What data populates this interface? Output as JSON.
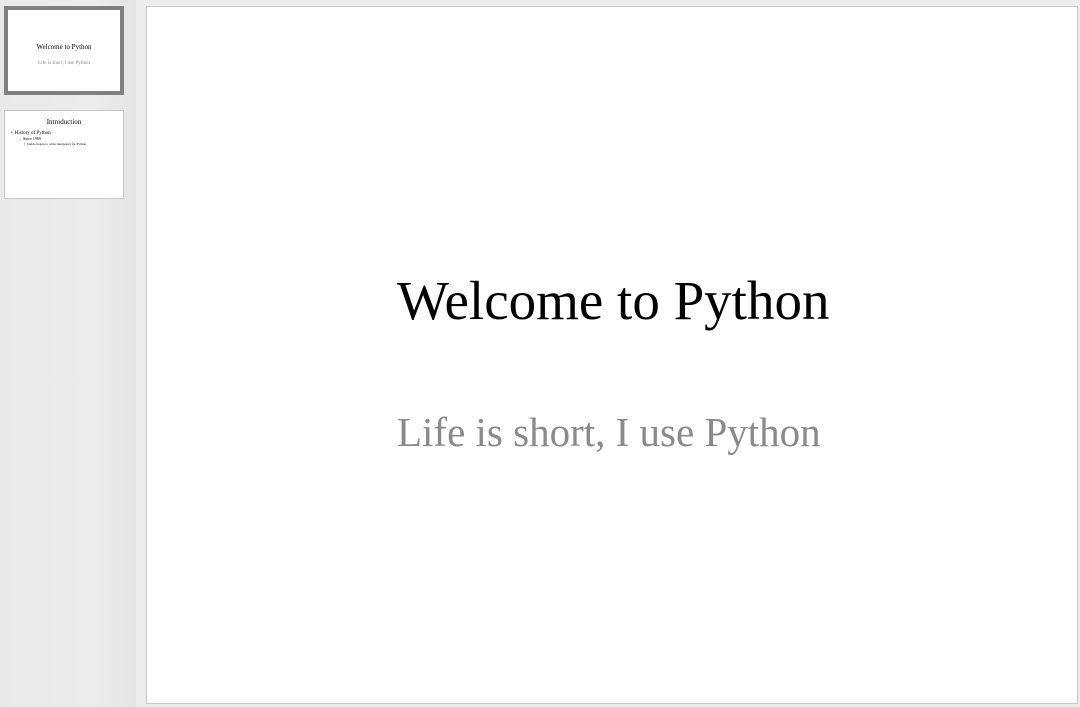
{
  "slides": [
    {
      "title": "Welcome to Python",
      "subtitle": "Life is short, I use Python"
    },
    {
      "title": "Introduction",
      "bullets": [
        {
          "bullet": "•",
          "text": "History of Python"
        },
        {
          "bullet": "–",
          "text": "Since 1989"
        },
        {
          "bullet": "•",
          "text": "Guido began to write interpreter for Python."
        }
      ]
    }
  ],
  "current_slide": {
    "title": "Welcome to Python",
    "subtitle": "Life is short, I use Python"
  },
  "colors": {
    "selected_border": "#808080",
    "subtitle_text": "#8a8a8a",
    "background": "#ececec"
  }
}
